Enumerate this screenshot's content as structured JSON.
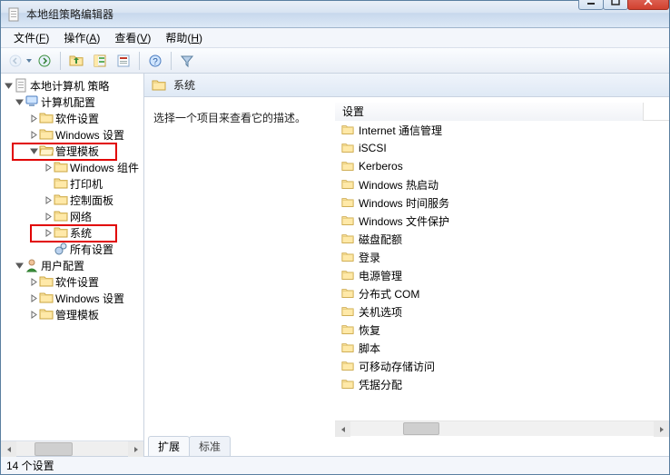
{
  "window": {
    "title": "本地组策略编辑器"
  },
  "menu": {
    "file": "文件(",
    "file_hk": "F",
    "file_end": ")",
    "action": "操作(",
    "action_hk": "A",
    "action_end": ")",
    "view": "查看(",
    "view_hk": "V",
    "view_end": ")",
    "help": "帮助(",
    "help_hk": "H",
    "help_end": ")"
  },
  "tree": {
    "root": "本地计算机 策略",
    "computer_config": "计算机配置",
    "software_settings": "软件设置",
    "windows_settings": "Windows 设置",
    "admin_templates": "管理模板",
    "windows_components": "Windows 组件",
    "printers": "打印机",
    "control_panel": "控制面板",
    "network": "网络",
    "system": "系统",
    "all_settings": "所有设置",
    "user_config": "用户配置",
    "u_software_settings": "软件设置",
    "u_windows_settings": "Windows 设置",
    "u_admin_templates": "管理模板"
  },
  "detail": {
    "header": "系统",
    "description": "选择一个项目来查看它的描述。",
    "column_settings": "设置",
    "items": [
      "Internet 通信管理",
      "iSCSI",
      "Kerberos",
      "Windows 热启动",
      "Windows 时间服务",
      "Windows 文件保护",
      "磁盘配额",
      "登录",
      "电源管理",
      "分布式 COM",
      "关机选项",
      "恢复",
      "脚本",
      "可移动存储访问",
      "凭据分配"
    ],
    "tab_extended": "扩展",
    "tab_standard": "标准"
  },
  "status": "14 个设置"
}
